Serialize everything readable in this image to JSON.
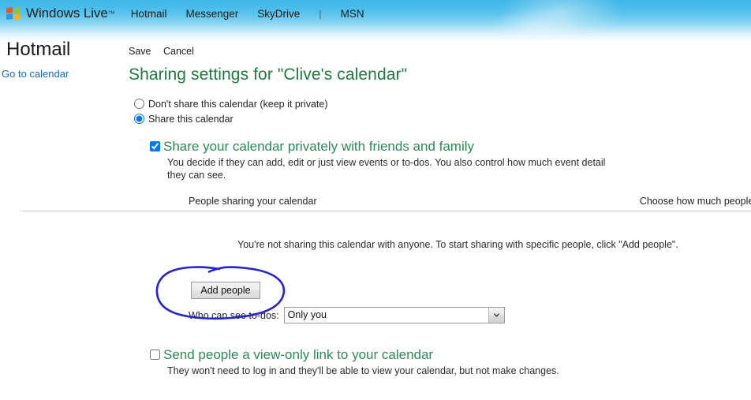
{
  "header": {
    "logo_text": "Windows Live",
    "logo_tm": "™",
    "logo_icon": "windows-flag-icon",
    "nav": [
      {
        "label": "Hotmail",
        "type": "link"
      },
      {
        "label": "Messenger",
        "type": "link"
      },
      {
        "label": "SkyDrive",
        "type": "link"
      },
      {
        "label": "|",
        "type": "separator"
      },
      {
        "label": "MSN",
        "type": "link"
      }
    ],
    "gradient_top_color": "#3fb6e8",
    "gradient_bottom_color": "#ffffff"
  },
  "sidebar": {
    "app_title": "Hotmail",
    "calendar_link": "Go to calendar",
    "link_color": "#1569c7"
  },
  "main": {
    "commands": [
      {
        "label": "Save",
        "name": "save-command"
      },
      {
        "label": "Cancel",
        "name": "cancel-command"
      }
    ],
    "page_title": "Sharing settings for \"Clive's calendar\"",
    "title_color": "#1f7a3d",
    "share_mode": {
      "options": [
        {
          "label": "Don't share this calendar (keep it private)",
          "selected": false
        },
        {
          "label": "Share this calendar",
          "selected": true
        }
      ]
    },
    "private_section": {
      "checked": true,
      "title": "Share your calendar privately with friends and family",
      "description": "You decide if they can add, edit or just view events or to-dos. You also control how much event detail they can see.",
      "table_headers": {
        "people": "People sharing your calendar",
        "permission": "Choose how much people see"
      },
      "empty_state": "You're not sharing this calendar with anyone. To start sharing with specific people, click \"Add people\".",
      "add_people_label": "Add people",
      "annotation": {
        "shape": "hand-drawn-ellipse",
        "color": "#2323d4",
        "target": "Add people"
      },
      "todo_label": "Who can see to-dos:",
      "todo_selected": "Only you",
      "todo_options": [
        "Only you"
      ]
    },
    "viewonly_section": {
      "checked": false,
      "title": "Send people a view-only link to your calendar",
      "description": "They won't need to log in and they'll be able to view your calendar, but not make changes."
    }
  }
}
